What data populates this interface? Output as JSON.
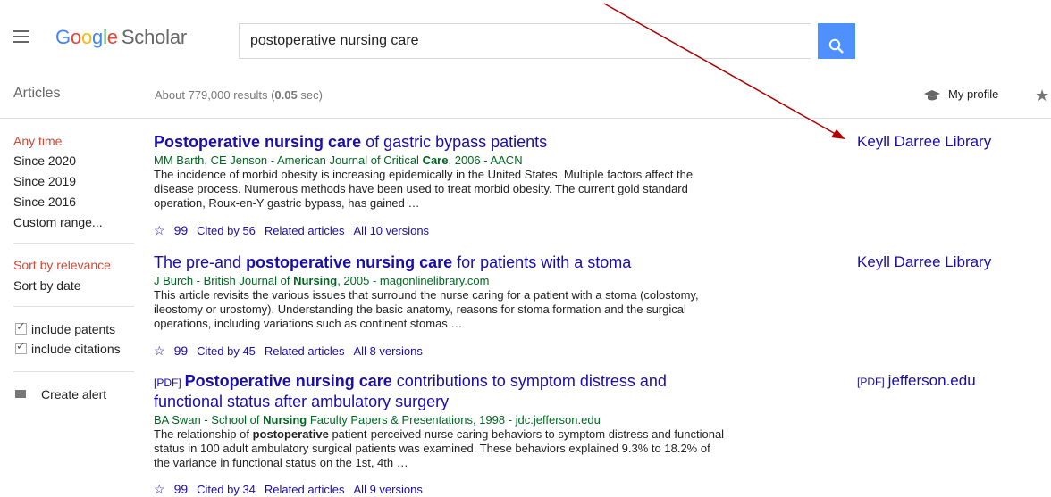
{
  "header": {
    "logo": {
      "letters": [
        "G",
        "o",
        "o",
        "g",
        "l",
        "e"
      ],
      "suffix": "Scholar"
    },
    "search_value": "postoperative nursing care",
    "search_icon": "search-icon",
    "menu_icon": "hamburger-menu-icon"
  },
  "subheader": {
    "articles_label": "Articles",
    "results_prefix": "About 779,000 results (",
    "results_time": "0.05",
    "results_suffix": " sec)",
    "my_profile": "My profile",
    "my_library_icon": "star-icon"
  },
  "sidebar": {
    "time_filters": [
      "Any time",
      "Since 2020",
      "Since 2019",
      "Since 2016",
      "Custom range..."
    ],
    "sort_options": [
      "Sort by relevance",
      "Sort by date"
    ],
    "checkboxes": [
      "include patents",
      "include citations"
    ],
    "create_alert": "Create alert"
  },
  "results": [
    {
      "title_bold": "Postoperative nursing care",
      "title_rest": " of gastric bypass patients",
      "authors_a": "MM Barth, CE Jenson - American Journal of Critical ",
      "authors_bold": "Care",
      "authors_b": ", 2006 - AACN",
      "snippet": "The incidence of morbid obesity is increasing epidemically in the United States. Multiple factors affect the disease process. Numerous methods have been used to treat morbid obesity. The current gold standard operation, Roux-en-Y gastric bypass, has gained …",
      "cited_by": "Cited by 56",
      "related": "Related articles",
      "versions": "All 10 versions",
      "library": "Keyll Darree Library"
    },
    {
      "title_a": "The pre-and ",
      "title_bold": "postoperative nursing care",
      "title_rest": " for patients with a stoma",
      "authors_a": "J Burch - British Journal of ",
      "authors_bold": "Nursing",
      "authors_b": ", 2005 - magonlinelibrary.com",
      "snippet": "This article revisits the various issues that surround the nurse caring for a patient with a stoma (colostomy, ileostomy or urostomy). Understanding the basic anatomy, reasons for stoma formation and the surgical operations, including variations such as continent stomas …",
      "cited_by": "Cited by 45",
      "related": "Related articles",
      "versions": "All 8 versions",
      "library": "Keyll Darree Library"
    },
    {
      "pdf_tag": "[PDF]",
      "title_bold": "Postoperative nursing care",
      "title_rest": " contributions to symptom distress and",
      "title_line2": "functional status after ambulatory surgery",
      "authors_a": "BA Swan - School of ",
      "authors_bold": "Nursing",
      "authors_b": " Faculty Papers & Presentations, 1998 - jdc.jefferson.edu",
      "snippet_a": "The relationship of ",
      "snippet_bold": "postoperative",
      "snippet_b": " patient-perceived nurse caring behaviors to symptom distress and functional status in 100 adult ambulatory surgical patients was examined. These behaviors explained 9.3% to 18.2% of the variance in functional status on the 1st, 4th …",
      "cited_by": "Cited by 34",
      "related": "Related articles",
      "versions": "All 9 versions",
      "library_tag": "[PDF]",
      "library": "jefferson.edu"
    }
  ],
  "icons": {
    "save": "star-outline-icon",
    "cite": "quote-icon"
  },
  "colors": {
    "accent": "#4d90fe",
    "link": "#1a0dab",
    "green": "#006621",
    "red_filter": "#d14836",
    "arrow": "#b00000"
  }
}
